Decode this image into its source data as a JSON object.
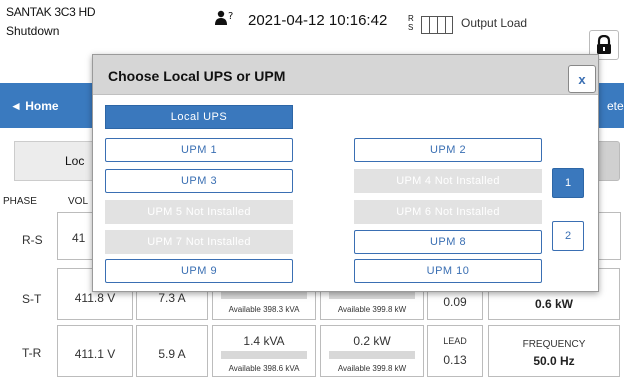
{
  "status_bar": {
    "brand": "SANTAK 3C3 HD",
    "mode": "Shutdown",
    "alarm_count": "?",
    "datetime": "2021-04-12 10:16:42",
    "phase_indicator": [
      "R",
      "S"
    ],
    "output_load_label": "Output Load"
  },
  "nav": {
    "home_label": "◄ Home",
    "meters_label": "eters"
  },
  "background": {
    "tab_local": "Loc",
    "table_headers": {
      "phase": "PHASE",
      "voltage": "VOL"
    },
    "rows": [
      {
        "phase": "R-S",
        "voltage": "41"
      },
      {
        "phase": "S-T",
        "voltage": "411.8 V",
        "current": "7.3 A",
        "avail_kva": "Available 398.3 kVA",
        "avail_kw": "Available 399.8 kW",
        "pf": "0.09",
        "total_kw": "0.6 kW"
      },
      {
        "phase": "T-R",
        "voltage": "411.1 V",
        "current": "5.9 A",
        "kva": "1.4 kVA",
        "avail_kva": "Available 398.6 kVA",
        "kw": "0.2 kW",
        "avail_kw": "Available 399.8 kW",
        "pf_label": "LEAD",
        "pf": "0.13",
        "freq_label": "FREQUENCY",
        "freq": "50.0 Hz"
      }
    ]
  },
  "dialog": {
    "title": "Choose Local UPS or UPM",
    "close_label": "x",
    "local_ups": "Local UPS",
    "left_options": [
      "UPM 1",
      "UPM 3",
      "UPM 5 Not Installed",
      "UPM 7 Not Installed",
      "UPM 9"
    ],
    "right_options": [
      "UPM 2",
      "UPM 4 Not Installed",
      "UPM 6 Not Installed",
      "UPM 8",
      "UPM 10"
    ],
    "pages": [
      "1",
      "2"
    ],
    "current_page": "1"
  }
}
